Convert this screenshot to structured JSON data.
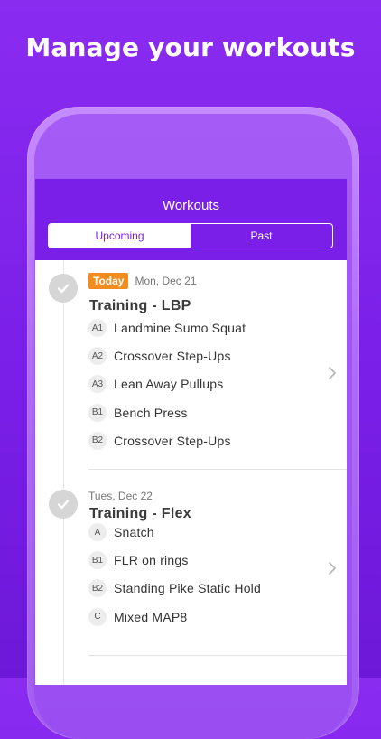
{
  "headline": "Manage your workouts",
  "nav": {
    "title": "Workouts",
    "tabs": [
      {
        "label": "Upcoming",
        "active": true
      },
      {
        "label": "Past",
        "active": false
      }
    ]
  },
  "workouts": [
    {
      "badge": "Today",
      "date": "Mon, Dec 21",
      "title": "Training - LBP",
      "completed": true,
      "exercises": [
        {
          "code": "A1",
          "name": "Landmine Sumo Squat"
        },
        {
          "code": "A2",
          "name": "Crossover Step-Ups"
        },
        {
          "code": "A3",
          "name": "Lean Away Pullups"
        },
        {
          "code": "B1",
          "name": "Bench Press"
        },
        {
          "code": "B2",
          "name": "Crossover Step-Ups"
        }
      ]
    },
    {
      "date": "Tues, Dec 22",
      "title": "Training - Flex",
      "completed": true,
      "exercises": [
        {
          "code": "A",
          "name": "Snatch"
        },
        {
          "code": "B1",
          "name": "FLR on rings"
        },
        {
          "code": "B2",
          "name": "Standing Pike Static Hold"
        },
        {
          "code": "C",
          "name": "Mixed MAP8"
        }
      ]
    }
  ],
  "colors": {
    "brand": "#7a1fe8",
    "today_badge": "#f28c1e",
    "check_circle": "#d6d6d6"
  },
  "icons": {
    "check": "check-icon",
    "chevron": "chevron-right-icon"
  }
}
